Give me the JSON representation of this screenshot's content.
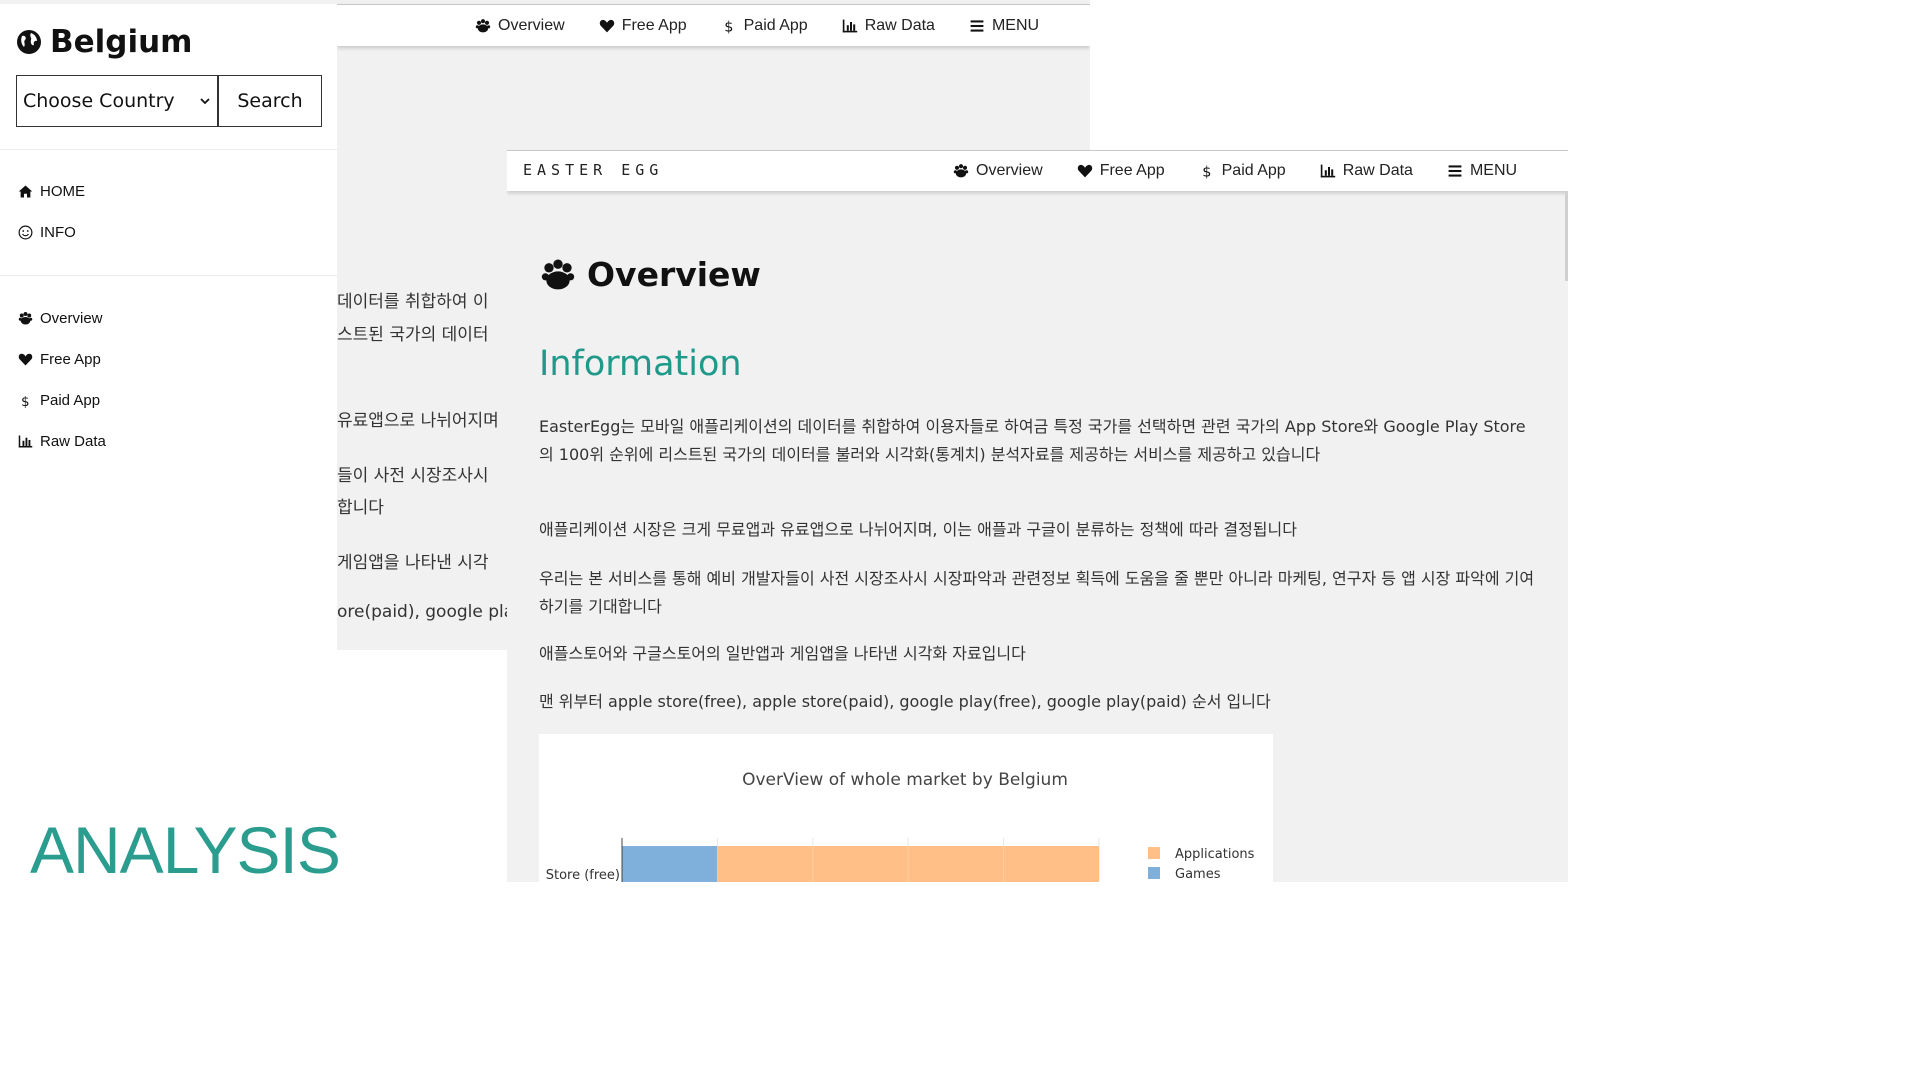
{
  "sidebar": {
    "title": "Belgium",
    "select_value": "Choose Country",
    "search_label": "Search",
    "nav_primary": [
      {
        "label": "HOME",
        "icon": "home-icon"
      },
      {
        "label": "INFO",
        "icon": "smile-icon"
      }
    ],
    "nav_secondary": [
      {
        "label": "Overview",
        "icon": "paw-icon"
      },
      {
        "label": "Free App",
        "icon": "heart-icon"
      },
      {
        "label": "Paid App",
        "icon": "dollar-icon"
      },
      {
        "label": "Raw Data",
        "icon": "bar-chart-icon"
      }
    ]
  },
  "topnav": {
    "items": [
      {
        "label": "Overview",
        "icon": "paw-icon"
      },
      {
        "label": "Free App",
        "icon": "heart-icon"
      },
      {
        "label": "Paid App",
        "icon": "dollar-icon"
      },
      {
        "label": "Raw Data",
        "icon": "bar-chart-icon"
      },
      {
        "label": "MENU",
        "icon": "menu-icon"
      }
    ]
  },
  "back_fragments": [
    "데이터를 취합하여 이",
    "스트된 국가의 데이터",
    "유료앱으로 나뉘어지며",
    "들이 사전 시장조사시",
    "합니다",
    "게임앱을 나타낸 시각",
    "ore(paid), google play"
  ],
  "front": {
    "brand": "EASTER EGG",
    "overview_heading": "Overview",
    "info_heading": "Information",
    "paragraphs": [
      "EasterEgg는 모바일 애플리케이션의 데이터를 취합하여 이용자들로 하여금 특정 국가를 선택하면 관련 국가의 App Store와 Google Play Store의 100위 순위에 리스트된 국가의 데이터를 불러와 시각화(통계치) 분석자료를 제공하는 서비스를 제공하고 있습니다",
      "애플리케이션 시장은 크게 무료앱과 유료앱으로 나뉘어지며, 이는 애플과 구글이 분류하는 정책에 따라 결정됩니다",
      "우리는 본 서비스를 통해 예비 개발자들이 사전 시장조사시 시장파악과 관련정보 획득에 도움을 줄 뿐만 아니라 마케팅, 연구자 등 앱 시장 파악에 기여하기를 기대합니다",
      "애플스토어와 구글스토어의 일반앱과 게임앱을 나타낸 시각화 자료입니다",
      "맨 위부터 apple store(free), apple store(paid), google play(free), google play(paid) 순서 입니다"
    ]
  },
  "overlay_label": "ANALYSIS",
  "colors": {
    "accent": "#2a9d8f",
    "heading_teal": "#1f9a8a",
    "applications": "#ffbf86",
    "games": "#7fb0dc"
  },
  "chart_data": {
    "type": "bar",
    "orientation": "horizontal",
    "stacked": true,
    "title": "OverView of whole market by Belgium",
    "categories": [
      "Store (free)"
    ],
    "series": [
      {
        "name": "Games",
        "values": [
          20
        ]
      },
      {
        "name": "Applications",
        "values": [
          80
        ]
      }
    ],
    "xlim": [
      0,
      100
    ],
    "grid": true,
    "legend": "right"
  }
}
